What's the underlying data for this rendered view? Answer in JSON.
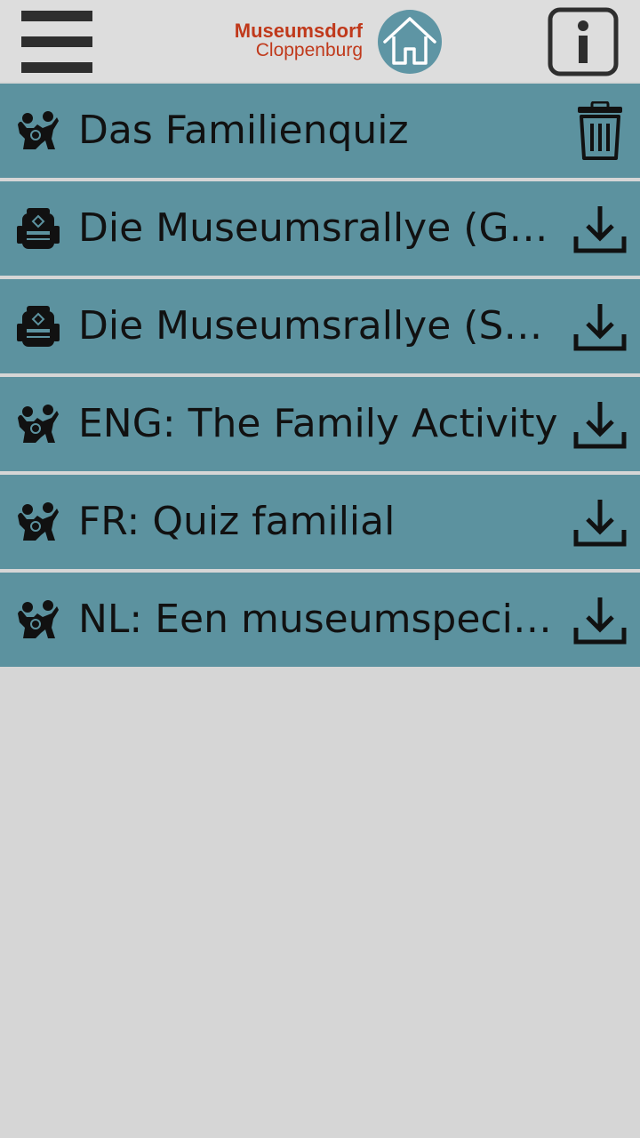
{
  "header": {
    "brand_line1": "Museumsdorf",
    "brand_line2": "Cloppenburg",
    "brand_color": "#c0391b",
    "menu_icon": "hamburger-menu-icon",
    "home_icon": "home-icon",
    "info_icon": "info-icon"
  },
  "list": {
    "items": [
      {
        "title": "Das Familienquiz",
        "type_icon": "family-icon",
        "action_icon": "trash-icon"
      },
      {
        "title": "Die Museumsrallye (Grundschule)",
        "type_icon": "backpack-icon",
        "action_icon": "download-icon"
      },
      {
        "title": "Die Museumsrallye (Sekundarstufe)",
        "type_icon": "backpack-icon",
        "action_icon": "download-icon"
      },
      {
        "title": "ENG: The Family Activity",
        "type_icon": "family-icon",
        "action_icon": "download-icon"
      },
      {
        "title": "FR: Quiz familial",
        "type_icon": "family-icon",
        "action_icon": "download-icon"
      },
      {
        "title": "NL: Een museumspeciaal",
        "type_icon": "family-icon",
        "action_icon": "download-icon"
      }
    ]
  },
  "colors": {
    "row_background": "#5c929f",
    "header_background": "#dddddd",
    "page_background": "#d6d6d6",
    "home_circle": "#5e95a4"
  }
}
